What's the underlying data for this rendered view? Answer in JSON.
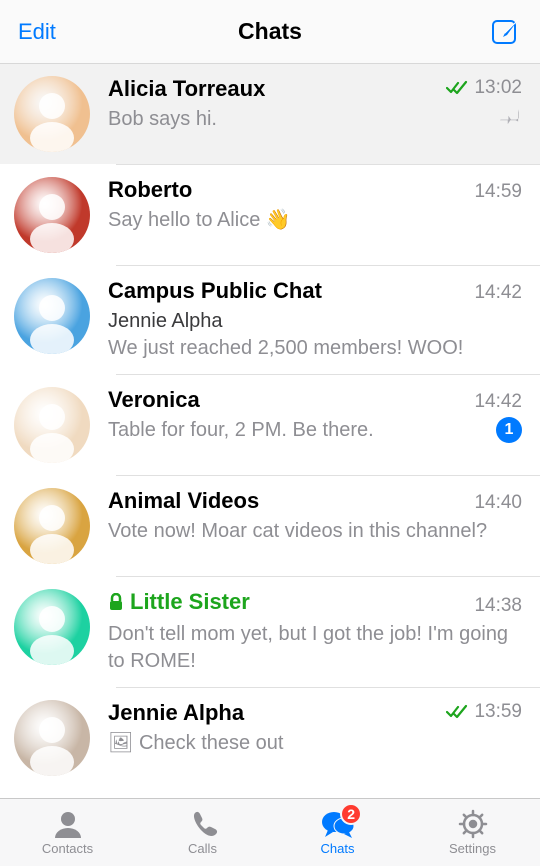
{
  "header": {
    "edit_label": "Edit",
    "title": "Chats",
    "compose_icon": "compose-icon"
  },
  "chats": [
    {
      "name": "Alicia Torreaux",
      "sender": null,
      "preview": "Bob says hi.",
      "time": "13:02",
      "read_checks": true,
      "pinned": true,
      "unread": 0,
      "secret": false,
      "avatar_bg": "#f0c090",
      "has_photo": false
    },
    {
      "name": "Roberto",
      "sender": null,
      "preview": "Say hello to Alice 👋",
      "time": "14:59",
      "read_checks": false,
      "pinned": false,
      "unread": 0,
      "secret": false,
      "avatar_bg": "#c0392b",
      "has_photo": false
    },
    {
      "name": "Campus Public Chat",
      "sender": "Jennie Alpha",
      "preview": "We just reached 2,500 members! WOO!",
      "time": "14:42",
      "read_checks": false,
      "pinned": false,
      "unread": 0,
      "secret": false,
      "avatar_bg": "#4aa3e0",
      "has_photo": false
    },
    {
      "name": "Veronica",
      "sender": null,
      "preview": "Table for four, 2 PM. Be there.",
      "time": "14:42",
      "read_checks": false,
      "pinned": false,
      "unread": 1,
      "secret": false,
      "avatar_bg": "#f0dac0",
      "has_photo": false
    },
    {
      "name": "Animal Videos",
      "sender": null,
      "preview": "Vote now! Moar cat videos in this channel?",
      "time": "14:40",
      "read_checks": false,
      "pinned": false,
      "unread": 0,
      "secret": false,
      "avatar_bg": "#d9a441",
      "has_photo": false
    },
    {
      "name": "Little Sister",
      "sender": null,
      "preview": "Don't tell mom yet, but I got the job! I'm going to ROME!",
      "time": "14:38",
      "read_checks": false,
      "pinned": false,
      "unread": 0,
      "secret": true,
      "avatar_bg": "#1dd1a1",
      "has_photo": false
    },
    {
      "name": "Jennie Alpha",
      "sender": null,
      "preview": "Check these out",
      "time": "13:59",
      "read_checks": true,
      "pinned": false,
      "unread": 0,
      "secret": false,
      "avatar_bg": "#c8b6a6",
      "has_photo": true
    }
  ],
  "tabs": {
    "items": [
      {
        "label": "Contacts",
        "icon": "contacts-icon",
        "active": false,
        "badge": 0
      },
      {
        "label": "Calls",
        "icon": "calls-icon",
        "active": false,
        "badge": 0
      },
      {
        "label": "Chats",
        "icon": "chats-icon",
        "active": true,
        "badge": 2
      },
      {
        "label": "Settings",
        "icon": "settings-icon",
        "active": false,
        "badge": 0
      }
    ]
  }
}
